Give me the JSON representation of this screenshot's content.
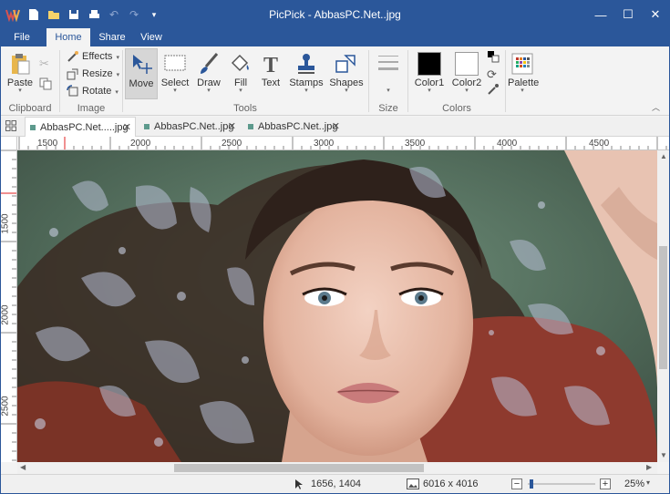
{
  "window": {
    "title": "PicPick - AbbasPC.Net..jpg",
    "accent": "#2b579a"
  },
  "quick_access": [
    "new-icon",
    "open-icon",
    "save-icon",
    "print-icon",
    "undo-icon",
    "redo-icon",
    "customize-icon"
  ],
  "ribbon_tabs": [
    {
      "label": "File",
      "active": false
    },
    {
      "label": "Home",
      "active": true
    },
    {
      "label": "Share",
      "active": false
    },
    {
      "label": "View",
      "active": false
    }
  ],
  "ribbon": {
    "clipboard": {
      "paste": "Paste",
      "group": "Clipboard"
    },
    "image": {
      "effects": "Effects",
      "resize": "Resize",
      "rotate": "Rotate",
      "group": "Image"
    },
    "tools": {
      "move": "Move",
      "select": "Select",
      "draw": "Draw",
      "fill": "Fill",
      "text": "Text",
      "stamps": "Stamps",
      "shapes": "Shapes",
      "group": "Tools"
    },
    "size": {
      "group": "Size"
    },
    "colors": {
      "color1": "Color1",
      "color2": "Color2",
      "group": "Colors",
      "color1_value": "#000000",
      "color2_value": "#ffffff"
    },
    "palette": {
      "label": "Palette"
    }
  },
  "doc_tabs": [
    {
      "label": "AbbasPC.Net.....jpg",
      "active": true
    },
    {
      "label": "AbbasPC.Net..jpg",
      "active": false
    },
    {
      "label": "AbbasPC.Net..jpg",
      "active": false
    }
  ],
  "ruler_h": [
    "1500",
    "2000",
    "2500",
    "3000",
    "3500",
    "4000",
    "4500"
  ],
  "ruler_v": [
    "1500",
    "2000",
    "2500"
  ],
  "status": {
    "cursor_pos": "1656, 1404",
    "image_size": "6016 x 4016",
    "zoom": "25%",
    "zoom_level": 0.25
  }
}
